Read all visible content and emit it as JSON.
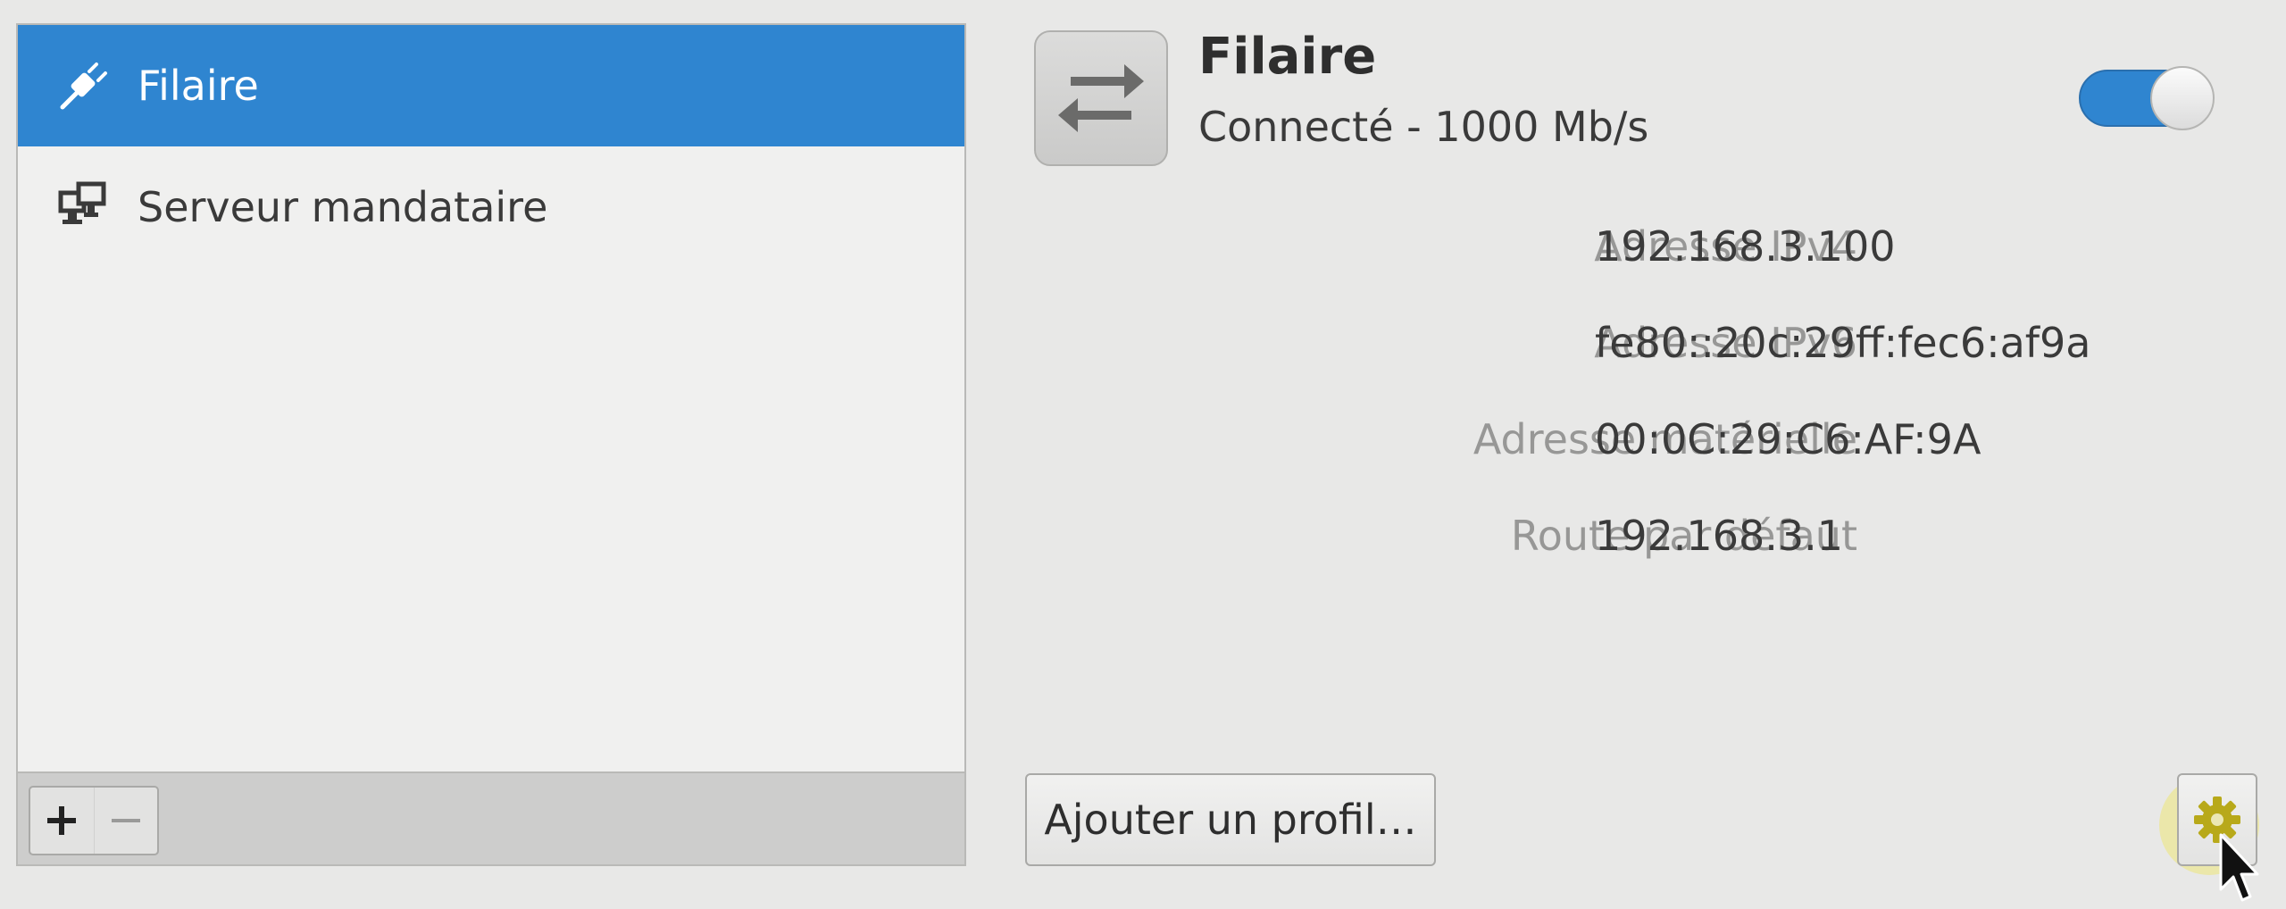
{
  "connections": {
    "items": [
      {
        "label": "Filaire",
        "icon": "wired-plug-icon",
        "selected": true
      },
      {
        "label": "Serveur mandataire",
        "icon": "proxy-network-icon",
        "selected": false
      }
    ],
    "toolbar": {
      "add_label": "+",
      "remove_label": "−"
    }
  },
  "device": {
    "icon": "network-transfer-arrows-icon",
    "title": "Filaire",
    "status": "Connecté - 1000 Mb/s",
    "enabled": true
  },
  "properties": [
    {
      "label": "Adresse IPv4",
      "value": "192.168.3.100"
    },
    {
      "label": "Adresse IPv6",
      "value": "fe80::20c:29ff:fec6:af9a"
    },
    {
      "label": "Adresse matérielle",
      "value": "00:0C:29:C6:AF:9A"
    },
    {
      "label": "Route par défaut",
      "value": "192.168.3.1"
    }
  ],
  "actions": {
    "add_profile_label": "Ajouter un profil…",
    "settings_icon": "gear-icon"
  },
  "colors": {
    "accent": "#2f85d0",
    "window_bg": "#e8e8e7",
    "list_bg": "#f0f0ef",
    "label_gray": "#979796",
    "gear_yellow": "#b8a91a"
  }
}
